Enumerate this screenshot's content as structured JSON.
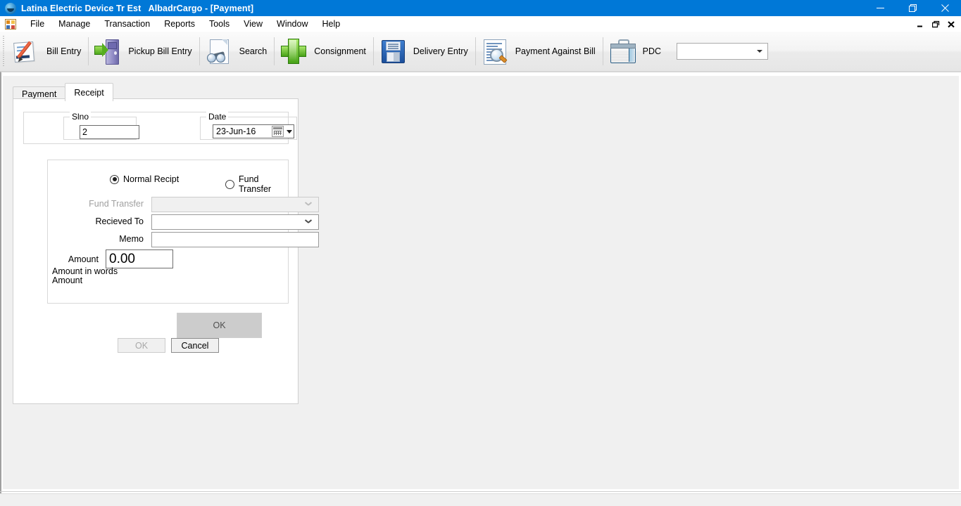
{
  "window": {
    "title": "Latina Electric Device Tr Est   AlbadrCargo - [Payment]",
    "app_icon": "app-globe-icon",
    "controls": {
      "minimize": "minimize-icon",
      "maximize": "maximize-icon",
      "close": "close-icon"
    }
  },
  "menubar": {
    "system_icon": "mdi-system-icon",
    "items": [
      {
        "label": "File"
      },
      {
        "label": "Manage"
      },
      {
        "label": "Transaction"
      },
      {
        "label": "Reports"
      },
      {
        "label": "Tools"
      },
      {
        "label": "View"
      },
      {
        "label": "Window"
      },
      {
        "label": "Help"
      }
    ]
  },
  "mdi_child_controls": {
    "minimize": "–",
    "restore": "❐",
    "close": "✖"
  },
  "toolbar": {
    "items": [
      {
        "label": "Bill Entry",
        "icon": "bill-entry-icon"
      },
      {
        "label": "Pickup Bill Entry",
        "icon": "pickup-bill-entry-icon"
      },
      {
        "label": "Search",
        "icon": "search-icon"
      },
      {
        "label": "Consignment",
        "icon": "consignment-icon"
      },
      {
        "label": "Delivery Entry",
        "icon": "delivery-entry-icon"
      },
      {
        "label": "Payment Against Bill",
        "icon": "payment-against-bill-icon"
      },
      {
        "label": "PDC",
        "icon": "pdc-briefcase-icon"
      }
    ],
    "pdc_combo": {
      "value": "",
      "placeholder": ""
    }
  },
  "form": {
    "tabs": [
      {
        "label": "Payment",
        "active": false
      },
      {
        "label": "Receipt",
        "active": true
      }
    ],
    "header": {
      "slno": {
        "legend": "Slno",
        "value": "2"
      },
      "date": {
        "legend": "Date",
        "value": "23-Jun-16",
        "calendar_icon": "calendar-icon",
        "dropdown_icon": "chevron-down-icon"
      }
    },
    "receipt": {
      "radios": [
        {
          "label": "Normal Recipt",
          "checked": true
        },
        {
          "label": "Fund Transfer",
          "checked": false
        }
      ],
      "fields": {
        "fund_transfer": {
          "label": "Fund Transfer",
          "value": "",
          "disabled": true
        },
        "recieved_to": {
          "label": "Recieved To",
          "value": "",
          "disabled": false
        },
        "memo": {
          "label": "Memo",
          "value": "",
          "placeholder": ""
        },
        "amount": {
          "label": "Amount",
          "value": "0.00"
        }
      },
      "amount_in_words_label": "Amount in words",
      "amount_words_value": "Amount",
      "inner_ok_label": "OK"
    },
    "buttons": {
      "ok": {
        "label": "OK",
        "enabled": false
      },
      "cancel": {
        "label": "Cancel",
        "enabled": true
      }
    }
  },
  "colors": {
    "titlebar": "#0078d7",
    "menubar": "#ffffff",
    "toolbar": "#f2f2f2",
    "client": "#ffffff",
    "form_face": "#f0f0f0"
  }
}
